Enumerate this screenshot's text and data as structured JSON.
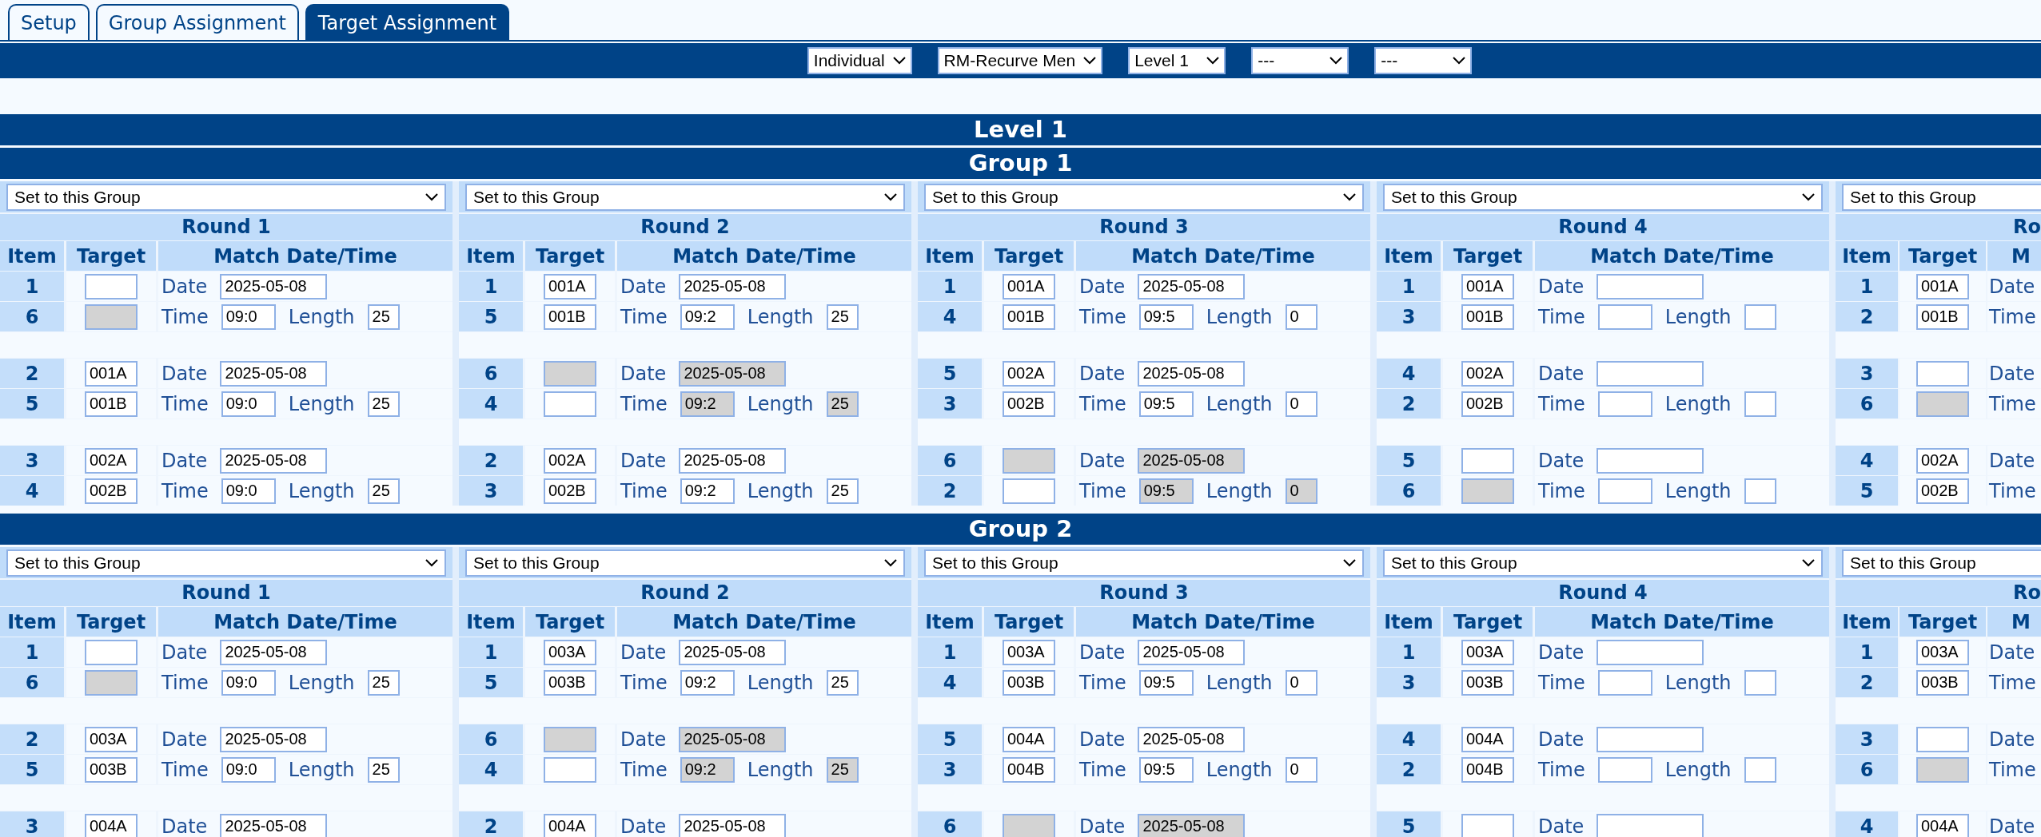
{
  "tabs": [
    {
      "label": "Setup",
      "selected": false
    },
    {
      "label": "Group Assignment",
      "selected": false
    },
    {
      "label": "Target Assignment",
      "selected": true
    }
  ],
  "filters": [
    "Individual",
    "RM-Recurve Men",
    "Level 1",
    "---",
    "---"
  ],
  "level_title": "Level 1",
  "groups": [
    {
      "title": "Group 1",
      "rounds": [
        {
          "kind": "full",
          "select": "Set to this Group",
          "title": "Round 1",
          "headers": [
            "Item",
            "Target",
            "Match Date/Time"
          ],
          "pairs": [
            {
              "lines": [
                {
                  "item": "1",
                  "target": {
                    "disabled": false
                  },
                  "fields": [
                    {
                      "kind": "label",
                      "text": "Date"
                    },
                    {
                      "kind": "date",
                      "value": "2025-05-08",
                      "disabled": false
                    }
                  ]
                },
                {
                  "item": "6",
                  "target": {
                    "disabled": true
                  },
                  "fields": [
                    {
                      "kind": "label",
                      "text": "Time"
                    },
                    {
                      "kind": "time",
                      "value": "09:0",
                      "disabled": false
                    },
                    {
                      "kind": "label",
                      "text": "Length"
                    },
                    {
                      "kind": "length",
                      "value": "25",
                      "disabled": false
                    }
                  ]
                }
              ]
            },
            {
              "lines": [
                {
                  "item": "2",
                  "target": {
                    "value": "001A",
                    "disabled": false
                  },
                  "fields": [
                    {
                      "kind": "label",
                      "text": "Date"
                    },
                    {
                      "kind": "date",
                      "value": "2025-05-08",
                      "disabled": false
                    }
                  ]
                },
                {
                  "item": "5",
                  "target": {
                    "value": "001B",
                    "disabled": false
                  },
                  "fields": [
                    {
                      "kind": "label",
                      "text": "Time"
                    },
                    {
                      "kind": "time",
                      "value": "09:0",
                      "disabled": false
                    },
                    {
                      "kind": "label",
                      "text": "Length"
                    },
                    {
                      "kind": "length",
                      "value": "25",
                      "disabled": false
                    }
                  ]
                }
              ]
            },
            {
              "lines": [
                {
                  "item": "3",
                  "target": {
                    "value": "002A",
                    "disabled": false
                  },
                  "fields": [
                    {
                      "kind": "label",
                      "text": "Date"
                    },
                    {
                      "kind": "date",
                      "value": "2025-05-08",
                      "disabled": false
                    }
                  ]
                },
                {
                  "item": "4",
                  "target": {
                    "value": "002B",
                    "disabled": false
                  },
                  "fields": [
                    {
                      "kind": "label",
                      "text": "Time"
                    },
                    {
                      "kind": "time",
                      "value": "09:0",
                      "disabled": false
                    },
                    {
                      "kind": "label",
                      "text": "Length"
                    },
                    {
                      "kind": "length",
                      "value": "25",
                      "disabled": false
                    }
                  ]
                }
              ]
            }
          ]
        },
        {
          "kind": "full",
          "select": "Set to this Group",
          "title": "Round 2",
          "headers": [
            "Item",
            "Target",
            "Match Date/Time"
          ],
          "pairs": [
            {
              "lines": [
                {
                  "item": "1",
                  "target": {
                    "value": "001A",
                    "disabled": false
                  },
                  "fields": [
                    {
                      "kind": "label",
                      "text": "Date"
                    },
                    {
                      "kind": "date",
                      "value": "2025-05-08",
                      "disabled": false
                    }
                  ]
                },
                {
                  "item": "5",
                  "target": {
                    "value": "001B",
                    "disabled": false
                  },
                  "fields": [
                    {
                      "kind": "label",
                      "text": "Time"
                    },
                    {
                      "kind": "time",
                      "value": "09:2",
                      "disabled": false
                    },
                    {
                      "kind": "label",
                      "text": "Length"
                    },
                    {
                      "kind": "length",
                      "value": "25",
                      "disabled": false
                    }
                  ]
                }
              ]
            },
            {
              "lines": [
                {
                  "item": "6",
                  "target": {
                    "disabled": true
                  },
                  "fields": [
                    {
                      "kind": "label",
                      "text": "Date"
                    },
                    {
                      "kind": "date",
                      "value": "2025-05-08",
                      "disabled": true
                    }
                  ]
                },
                {
                  "item": "4",
                  "target": {
                    "disabled": false
                  },
                  "fields": [
                    {
                      "kind": "label",
                      "text": "Time"
                    },
                    {
                      "kind": "time",
                      "value": "09:2",
                      "disabled": true
                    },
                    {
                      "kind": "label",
                      "text": "Length"
                    },
                    {
                      "kind": "length",
                      "value": "25",
                      "disabled": true
                    }
                  ]
                }
              ]
            },
            {
              "lines": [
                {
                  "item": "2",
                  "target": {
                    "value": "002A",
                    "disabled": false
                  },
                  "fields": [
                    {
                      "kind": "label",
                      "text": "Date"
                    },
                    {
                      "kind": "date",
                      "value": "2025-05-08",
                      "disabled": false
                    }
                  ]
                },
                {
                  "item": "3",
                  "target": {
                    "value": "002B",
                    "disabled": false
                  },
                  "fields": [
                    {
                      "kind": "label",
                      "text": "Time"
                    },
                    {
                      "kind": "time",
                      "value": "09:2",
                      "disabled": false
                    },
                    {
                      "kind": "label",
                      "text": "Length"
                    },
                    {
                      "kind": "length",
                      "value": "25",
                      "disabled": false
                    }
                  ]
                }
              ]
            }
          ]
        },
        {
          "kind": "full",
          "select": "Set to this Group",
          "title": "Round 3",
          "headers": [
            "Item",
            "Target",
            "Match Date/Time"
          ],
          "pairs": [
            {
              "lines": [
                {
                  "item": "1",
                  "target": {
                    "value": "001A",
                    "disabled": false
                  },
                  "fields": [
                    {
                      "kind": "label",
                      "text": "Date"
                    },
                    {
                      "kind": "date",
                      "value": "2025-05-08",
                      "disabled": false
                    }
                  ]
                },
                {
                  "item": "4",
                  "target": {
                    "value": "001B",
                    "disabled": false
                  },
                  "fields": [
                    {
                      "kind": "label",
                      "text": "Time"
                    },
                    {
                      "kind": "time",
                      "value": "09:5",
                      "disabled": false
                    },
                    {
                      "kind": "label",
                      "text": "Length"
                    },
                    {
                      "kind": "length",
                      "value": "0",
                      "disabled": false
                    }
                  ]
                }
              ]
            },
            {
              "lines": [
                {
                  "item": "5",
                  "target": {
                    "value": "002A",
                    "disabled": false
                  },
                  "fields": [
                    {
                      "kind": "label",
                      "text": "Date"
                    },
                    {
                      "kind": "date",
                      "value": "2025-05-08",
                      "disabled": false
                    }
                  ]
                },
                {
                  "item": "3",
                  "target": {
                    "value": "002B",
                    "disabled": false
                  },
                  "fields": [
                    {
                      "kind": "label",
                      "text": "Time"
                    },
                    {
                      "kind": "time",
                      "value": "09:5",
                      "disabled": false
                    },
                    {
                      "kind": "label",
                      "text": "Length"
                    },
                    {
                      "kind": "length",
                      "value": "0",
                      "disabled": false
                    }
                  ]
                }
              ]
            },
            {
              "lines": [
                {
                  "item": "6",
                  "target": {
                    "disabled": true
                  },
                  "fields": [
                    {
                      "kind": "label",
                      "text": "Date"
                    },
                    {
                      "kind": "date",
                      "value": "2025-05-08",
                      "disabled": true
                    }
                  ]
                },
                {
                  "item": "2",
                  "target": {
                    "disabled": false
                  },
                  "fields": [
                    {
                      "kind": "label",
                      "text": "Time"
                    },
                    {
                      "kind": "time",
                      "value": "09:5",
                      "disabled": true
                    },
                    {
                      "kind": "label",
                      "text": "Length"
                    },
                    {
                      "kind": "length",
                      "value": "0",
                      "disabled": true
                    }
                  ]
                }
              ]
            }
          ]
        },
        {
          "kind": "full",
          "select": "Set to this Group",
          "title": "Round 4",
          "headers": [
            "Item",
            "Target",
            "Match Date/Time"
          ],
          "pairs": [
            {
              "lines": [
                {
                  "item": "1",
                  "target": {
                    "value": "001A",
                    "disabled": false
                  },
                  "fields": [
                    {
                      "kind": "label",
                      "text": "Date"
                    },
                    {
                      "kind": "date",
                      "disabled": false
                    }
                  ]
                },
                {
                  "item": "3",
                  "target": {
                    "value": "001B",
                    "disabled": false
                  },
                  "fields": [
                    {
                      "kind": "label",
                      "text": "Time"
                    },
                    {
                      "kind": "time",
                      "disabled": false
                    },
                    {
                      "kind": "label",
                      "text": "Length"
                    },
                    {
                      "kind": "length",
                      "disabled": false
                    }
                  ]
                }
              ]
            },
            {
              "lines": [
                {
                  "item": "4",
                  "target": {
                    "value": "002A",
                    "disabled": false
                  },
                  "fields": [
                    {
                      "kind": "label",
                      "text": "Date"
                    },
                    {
                      "kind": "date",
                      "disabled": false
                    }
                  ]
                },
                {
                  "item": "2",
                  "target": {
                    "value": "002B",
                    "disabled": false
                  },
                  "fields": [
                    {
                      "kind": "label",
                      "text": "Time"
                    },
                    {
                      "kind": "time",
                      "disabled": false
                    },
                    {
                      "kind": "label",
                      "text": "Length"
                    },
                    {
                      "kind": "length",
                      "disabled": false
                    }
                  ]
                }
              ]
            },
            {
              "lines": [
                {
                  "item": "5",
                  "target": {
                    "disabled": false
                  },
                  "fields": [
                    {
                      "kind": "label",
                      "text": "Date"
                    },
                    {
                      "kind": "date",
                      "disabled": false
                    }
                  ]
                },
                {
                  "item": "6",
                  "target": {
                    "disabled": true
                  },
                  "fields": [
                    {
                      "kind": "label",
                      "text": "Time"
                    },
                    {
                      "kind": "time",
                      "disabled": false
                    },
                    {
                      "kind": "label",
                      "text": "Length"
                    },
                    {
                      "kind": "length",
                      "disabled": false
                    }
                  ]
                }
              ]
            }
          ]
        },
        {
          "kind": "cut",
          "select": "Set to this Group",
          "title": "Ro",
          "headers": [
            "Item",
            "Target",
            "M"
          ],
          "pairs": [
            {
              "lines": [
                {
                  "item": "1",
                  "target": {
                    "value": "001A",
                    "disabled": false
                  },
                  "fields": [
                    {
                      "kind": "label",
                      "text": "Date"
                    }
                  ]
                },
                {
                  "item": "2",
                  "target": {
                    "value": "001B",
                    "disabled": false
                  },
                  "fields": [
                    {
                      "kind": "label",
                      "text": "Time"
                    }
                  ]
                }
              ]
            },
            {
              "lines": [
                {
                  "item": "3",
                  "target": {
                    "disabled": false
                  },
                  "fields": [
                    {
                      "kind": "label",
                      "text": "Date"
                    }
                  ]
                },
                {
                  "item": "6",
                  "target": {
                    "disabled": true
                  },
                  "fields": [
                    {
                      "kind": "label",
                      "text": "Time"
                    }
                  ]
                }
              ]
            },
            {
              "lines": [
                {
                  "item": "4",
                  "target": {
                    "value": "002A",
                    "disabled": false
                  },
                  "fields": [
                    {
                      "kind": "label",
                      "text": "Date"
                    }
                  ]
                },
                {
                  "item": "5",
                  "target": {
                    "value": "002B",
                    "disabled": false
                  },
                  "fields": [
                    {
                      "kind": "label",
                      "text": "Time"
                    }
                  ]
                }
              ]
            }
          ]
        }
      ]
    },
    {
      "title": "Group 2",
      "rounds": [
        {
          "kind": "full",
          "select": "Set to this Group",
          "title": "Round 1",
          "headers": [
            "Item",
            "Target",
            "Match Date/Time"
          ],
          "pairs": [
            {
              "lines": [
                {
                  "item": "1",
                  "target": {
                    "disabled": false
                  },
                  "fields": [
                    {
                      "kind": "label",
                      "text": "Date"
                    },
                    {
                      "kind": "date",
                      "value": "2025-05-08",
                      "disabled": false
                    }
                  ]
                },
                {
                  "item": "6",
                  "target": {
                    "disabled": true
                  },
                  "fields": [
                    {
                      "kind": "label",
                      "text": "Time"
                    },
                    {
                      "kind": "time",
                      "value": "09:0",
                      "disabled": false
                    },
                    {
                      "kind": "label",
                      "text": "Length"
                    },
                    {
                      "kind": "length",
                      "value": "25",
                      "disabled": false
                    }
                  ]
                }
              ]
            },
            {
              "lines": [
                {
                  "item": "2",
                  "target": {
                    "value": "003A",
                    "disabled": false
                  },
                  "fields": [
                    {
                      "kind": "label",
                      "text": "Date"
                    },
                    {
                      "kind": "date",
                      "value": "2025-05-08",
                      "disabled": false
                    }
                  ]
                },
                {
                  "item": "5",
                  "target": {
                    "value": "003B",
                    "disabled": false
                  },
                  "fields": [
                    {
                      "kind": "label",
                      "text": "Time"
                    },
                    {
                      "kind": "time",
                      "value": "09:0",
                      "disabled": false
                    },
                    {
                      "kind": "label",
                      "text": "Length"
                    },
                    {
                      "kind": "length",
                      "value": "25",
                      "disabled": false
                    }
                  ]
                }
              ]
            },
            {
              "lines": [
                {
                  "item": "3",
                  "target": {
                    "value": "004A",
                    "disabled": false
                  },
                  "fields": [
                    {
                      "kind": "label",
                      "text": "Date"
                    },
                    {
                      "kind": "date",
                      "value": "2025-05-08",
                      "disabled": false
                    }
                  ]
                }
              ]
            }
          ]
        },
        {
          "kind": "full",
          "select": "Set to this Group",
          "title": "Round 2",
          "headers": [
            "Item",
            "Target",
            "Match Date/Time"
          ],
          "pairs": [
            {
              "lines": [
                {
                  "item": "1",
                  "target": {
                    "value": "003A",
                    "disabled": false
                  },
                  "fields": [
                    {
                      "kind": "label",
                      "text": "Date"
                    },
                    {
                      "kind": "date",
                      "value": "2025-05-08",
                      "disabled": false
                    }
                  ]
                },
                {
                  "item": "5",
                  "target": {
                    "value": "003B",
                    "disabled": false
                  },
                  "fields": [
                    {
                      "kind": "label",
                      "text": "Time"
                    },
                    {
                      "kind": "time",
                      "value": "09:2",
                      "disabled": false
                    },
                    {
                      "kind": "label",
                      "text": "Length"
                    },
                    {
                      "kind": "length",
                      "value": "25",
                      "disabled": false
                    }
                  ]
                }
              ]
            },
            {
              "lines": [
                {
                  "item": "6",
                  "target": {
                    "disabled": true
                  },
                  "fields": [
                    {
                      "kind": "label",
                      "text": "Date"
                    },
                    {
                      "kind": "date",
                      "value": "2025-05-08",
                      "disabled": true
                    }
                  ]
                },
                {
                  "item": "4",
                  "target": {
                    "disabled": false
                  },
                  "fields": [
                    {
                      "kind": "label",
                      "text": "Time"
                    },
                    {
                      "kind": "time",
                      "value": "09:2",
                      "disabled": true
                    },
                    {
                      "kind": "label",
                      "text": "Length"
                    },
                    {
                      "kind": "length",
                      "value": "25",
                      "disabled": true
                    }
                  ]
                }
              ]
            },
            {
              "lines": [
                {
                  "item": "2",
                  "target": {
                    "value": "004A",
                    "disabled": false
                  },
                  "fields": [
                    {
                      "kind": "label",
                      "text": "Date"
                    },
                    {
                      "kind": "date",
                      "value": "2025-05-08",
                      "disabled": false
                    }
                  ]
                }
              ]
            }
          ]
        },
        {
          "kind": "full",
          "select": "Set to this Group",
          "title": "Round 3",
          "headers": [
            "Item",
            "Target",
            "Match Date/Time"
          ],
          "pairs": [
            {
              "lines": [
                {
                  "item": "1",
                  "target": {
                    "value": "003A",
                    "disabled": false
                  },
                  "fields": [
                    {
                      "kind": "label",
                      "text": "Date"
                    },
                    {
                      "kind": "date",
                      "value": "2025-05-08",
                      "disabled": false
                    }
                  ]
                },
                {
                  "item": "4",
                  "target": {
                    "value": "003B",
                    "disabled": false
                  },
                  "fields": [
                    {
                      "kind": "label",
                      "text": "Time"
                    },
                    {
                      "kind": "time",
                      "value": "09:5",
                      "disabled": false
                    },
                    {
                      "kind": "label",
                      "text": "Length"
                    },
                    {
                      "kind": "length",
                      "value": "0",
                      "disabled": false
                    }
                  ]
                }
              ]
            },
            {
              "lines": [
                {
                  "item": "5",
                  "target": {
                    "value": "004A",
                    "disabled": false
                  },
                  "fields": [
                    {
                      "kind": "label",
                      "text": "Date"
                    },
                    {
                      "kind": "date",
                      "value": "2025-05-08",
                      "disabled": false
                    }
                  ]
                },
                {
                  "item": "3",
                  "target": {
                    "value": "004B",
                    "disabled": false
                  },
                  "fields": [
                    {
                      "kind": "label",
                      "text": "Time"
                    },
                    {
                      "kind": "time",
                      "value": "09:5",
                      "disabled": false
                    },
                    {
                      "kind": "label",
                      "text": "Length"
                    },
                    {
                      "kind": "length",
                      "value": "0",
                      "disabled": false
                    }
                  ]
                }
              ]
            },
            {
              "lines": [
                {
                  "item": "6",
                  "target": {
                    "disabled": true
                  },
                  "fields": [
                    {
                      "kind": "label",
                      "text": "Date"
                    },
                    {
                      "kind": "date",
                      "value": "2025-05-08",
                      "disabled": true
                    }
                  ]
                }
              ]
            }
          ]
        },
        {
          "kind": "full",
          "select": "Set to this Group",
          "title": "Round 4",
          "headers": [
            "Item",
            "Target",
            "Match Date/Time"
          ],
          "pairs": [
            {
              "lines": [
                {
                  "item": "1",
                  "target": {
                    "value": "003A",
                    "disabled": false
                  },
                  "fields": [
                    {
                      "kind": "label",
                      "text": "Date"
                    },
                    {
                      "kind": "date",
                      "disabled": false
                    }
                  ]
                },
                {
                  "item": "3",
                  "target": {
                    "value": "003B",
                    "disabled": false
                  },
                  "fields": [
                    {
                      "kind": "label",
                      "text": "Time"
                    },
                    {
                      "kind": "time",
                      "disabled": false
                    },
                    {
                      "kind": "label",
                      "text": "Length"
                    },
                    {
                      "kind": "length",
                      "disabled": false
                    }
                  ]
                }
              ]
            },
            {
              "lines": [
                {
                  "item": "4",
                  "target": {
                    "value": "004A",
                    "disabled": false
                  },
                  "fields": [
                    {
                      "kind": "label",
                      "text": "Date"
                    },
                    {
                      "kind": "date",
                      "disabled": false
                    }
                  ]
                },
                {
                  "item": "2",
                  "target": {
                    "value": "004B",
                    "disabled": false
                  },
                  "fields": [
                    {
                      "kind": "label",
                      "text": "Time"
                    },
                    {
                      "kind": "time",
                      "disabled": false
                    },
                    {
                      "kind": "label",
                      "text": "Length"
                    },
                    {
                      "kind": "length",
                      "disabled": false
                    }
                  ]
                }
              ]
            },
            {
              "lines": [
                {
                  "item": "5",
                  "target": {
                    "disabled": false
                  },
                  "fields": [
                    {
                      "kind": "label",
                      "text": "Date"
                    },
                    {
                      "kind": "date",
                      "disabled": false
                    }
                  ]
                }
              ]
            }
          ]
        },
        {
          "kind": "cut",
          "select": "Set to this Group",
          "title": "Ro",
          "headers": [
            "Item",
            "Target",
            "M"
          ],
          "pairs": [
            {
              "lines": [
                {
                  "item": "1",
                  "target": {
                    "value": "003A",
                    "disabled": false
                  },
                  "fields": [
                    {
                      "kind": "label",
                      "text": "Date"
                    }
                  ]
                },
                {
                  "item": "2",
                  "target": {
                    "value": "003B",
                    "disabled": false
                  },
                  "fields": [
                    {
                      "kind": "label",
                      "text": "Time"
                    }
                  ]
                }
              ]
            },
            {
              "lines": [
                {
                  "item": "3",
                  "target": {
                    "disabled": false
                  },
                  "fields": [
                    {
                      "kind": "label",
                      "text": "Date"
                    }
                  ]
                },
                {
                  "item": "6",
                  "target": {
                    "disabled": true
                  },
                  "fields": [
                    {
                      "kind": "label",
                      "text": "Time"
                    }
                  ]
                }
              ]
            },
            {
              "lines": [
                {
                  "item": "4",
                  "target": {
                    "value": "004A",
                    "disabled": false
                  },
                  "fields": [
                    {
                      "kind": "label",
                      "text": "Date"
                    }
                  ]
                }
              ]
            }
          ]
        }
      ]
    }
  ]
}
